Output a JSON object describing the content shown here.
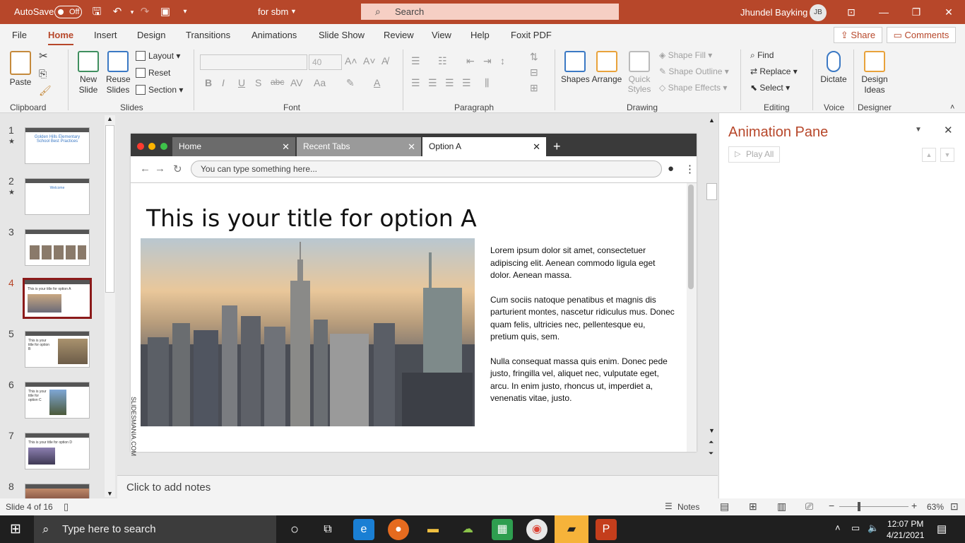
{
  "titlebar": {
    "autosave_label": "AutoSave",
    "autosave_state": "Off",
    "document_name": "for sbm",
    "search_placeholder": "Search",
    "user_name": "Jhundel Bayking",
    "user_initials": "JB",
    "accent_color": "#b7472a"
  },
  "menu": {
    "tabs": [
      "File",
      "Home",
      "Insert",
      "Design",
      "Transitions",
      "Animations",
      "Slide Show",
      "Review",
      "View",
      "Help",
      "Foxit PDF"
    ],
    "active_tab": "Home",
    "share_label": "Share",
    "comments_label": "Comments"
  },
  "ribbon": {
    "clipboard": {
      "paste": "Paste",
      "label": "Clipboard"
    },
    "slides": {
      "new_slide": "New Slide",
      "reuse_slides": "Reuse Slides",
      "layout": "Layout",
      "reset": "Reset",
      "section": "Section",
      "label": "Slides"
    },
    "font": {
      "size": "40",
      "label": "Font"
    },
    "paragraph": {
      "label": "Paragraph"
    },
    "drawing": {
      "shapes": "Shapes",
      "arrange": "Arrange",
      "quick_styles": "Quick Styles",
      "shape_fill": "Shape Fill",
      "shape_outline": "Shape Outline",
      "shape_effects": "Shape Effects",
      "label": "Drawing"
    },
    "editing": {
      "find": "Find",
      "replace": "Replace",
      "select": "Select",
      "label": "Editing"
    },
    "voice": {
      "dictate": "Dictate",
      "label": "Voice"
    },
    "designer": {
      "design_ideas": "Design Ideas",
      "label": "Designer"
    }
  },
  "thumbnails": [
    {
      "num": "1",
      "star": true,
      "title": "Golden Hills Elementary School Best Practices"
    },
    {
      "num": "2",
      "star": true,
      "title": "Welcome"
    },
    {
      "num": "3",
      "star": false,
      "title": ""
    },
    {
      "num": "4",
      "star": false,
      "title": "This is your title for option A"
    },
    {
      "num": "5",
      "star": false,
      "title": "This is your title for option B"
    },
    {
      "num": "6",
      "star": false,
      "title": "This is your title for option C"
    },
    {
      "num": "7",
      "star": false,
      "title": "This is your title for option D"
    },
    {
      "num": "8",
      "star": false,
      "title": ""
    }
  ],
  "slide": {
    "browser_tabs": [
      "Home",
      "Recent Tabs",
      "Option A"
    ],
    "url_placeholder": "You can type something here...",
    "title": "This is your title for option A",
    "paragraphs": [
      "Lorem ipsum dolor sit amet, consectetuer adipiscing elit. Aenean commodo ligula eget dolor. Aenean massa.",
      "Cum sociis natoque penatibus et magnis dis parturient montes, nascetur ridiculus mus. Donec quam felis, ultricies nec, pellentesque eu, pretium quis, sem.",
      "Nulla consequat massa quis enim. Donec pede justo, fringilla vel, aliquet nec, vulputate eget, arcu. In enim justo, rhoncus ut, imperdiet a, venenatis vitae, justo."
    ],
    "watermark": "SLIDESMANIA.COM"
  },
  "notes_placeholder": "Click to add notes",
  "animation_pane": {
    "title": "Animation Pane",
    "play_all": "Play All"
  },
  "status": {
    "slide_info": "Slide 4 of 16",
    "notes": "Notes",
    "zoom": "63%"
  },
  "taskbar": {
    "search_placeholder": "Type here to search",
    "time": "12:07 PM",
    "date": "4/21/2021"
  }
}
